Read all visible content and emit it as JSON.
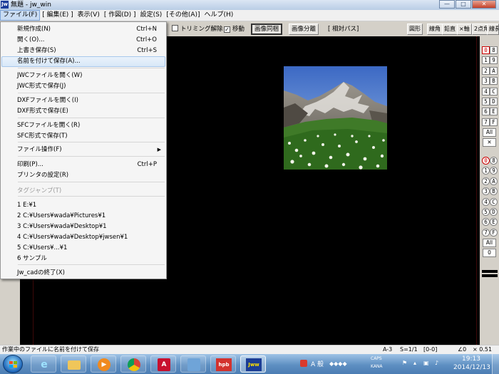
{
  "window": {
    "title": "無題 - jw_win",
    "icon_text": "Jw"
  },
  "menubar": [
    "ファイル(F)",
    "[ 編集(E) ]",
    "表示(V)",
    "[ 作図(D) ]",
    "設定(S)",
    "[その他(A)]",
    "ヘルプ(H)"
  ],
  "toolbar": {
    "trimming": "トリミング解除",
    "move": "移動",
    "move_checked": "✓",
    "image_same": "画像同梱",
    "image_split": "画像分離",
    "relative_path": "[ 相対パス]",
    "right_buttons": [
      "図形",
      "線角",
      "鉛直",
      "×軸",
      "2点角",
      "線長"
    ]
  },
  "file_menu": {
    "items": [
      {
        "label": "新規作成(N)",
        "shortcut": "Ctrl+N"
      },
      {
        "label": "開く(O)...",
        "shortcut": "Ctrl+O"
      },
      {
        "label": "上書き保存(S)",
        "shortcut": "Ctrl+S"
      },
      {
        "label": "名前を付けて保存(A)...",
        "shortcut": ""
      },
      {
        "label": "JWCファイルを開く(W)",
        "shortcut": ""
      },
      {
        "label": "JWC形式で保存(J)",
        "shortcut": ""
      },
      {
        "label": "DXFファイルを開く(I)",
        "shortcut": ""
      },
      {
        "label": "DXF形式で保存(E)",
        "shortcut": ""
      },
      {
        "label": "SFCファイルを開く(R)",
        "shortcut": ""
      },
      {
        "label": "SFC形式で保存(T)",
        "shortcut": ""
      },
      {
        "label": "ファイル操作(F)",
        "shortcut": "",
        "submenu_arrow": "▶"
      },
      {
        "label": "印刷(P)...",
        "shortcut": "Ctrl+P"
      },
      {
        "label": "プリンタの設定(R)",
        "shortcut": ""
      },
      {
        "label": "タグジャンプ(T)",
        "shortcut": ""
      },
      {
        "label": "1 E:¥1",
        "shortcut": ""
      },
      {
        "label": "2 C:¥Users¥wada¥Pictures¥1",
        "shortcut": ""
      },
      {
        "label": "3 C:¥Users¥wada¥Desktop¥1",
        "shortcut": ""
      },
      {
        "label": "4 C:¥Users¥wada¥Desktop¥jwsen¥1",
        "shortcut": ""
      },
      {
        "label": "5 C:¥Users¥...¥1",
        "shortcut": ""
      },
      {
        "label": "6 サンプル",
        "shortcut": ""
      },
      {
        "label": "Jw_cadの終了(X)",
        "shortcut": ""
      }
    ]
  },
  "right_panel": {
    "layer_group_buttons": [
      "0",
      "8",
      "1",
      "9",
      "2",
      "A",
      "3",
      "B",
      "4",
      "C",
      "5",
      "D",
      "6",
      "E",
      "7",
      "F"
    ],
    "all_label": "All",
    "cross_label": "✕",
    "layer_buttons": [
      "0",
      "8",
      "1",
      "9",
      "2",
      "A",
      "3",
      "B",
      "4",
      "C",
      "5",
      "D",
      "6",
      "E",
      "7",
      "F"
    ],
    "all_label_2": "All",
    "zero_label": "0"
  },
  "statusbar": {
    "message": "作業中のファイルに名前を付けて保存",
    "paper": "A-3",
    "scale": "S=1/1",
    "layer": "[0-0]",
    "angle": "∠0",
    "ratio": "× 0.51"
  },
  "taskbar": {
    "hpb_label": "hpb",
    "jww_label": "Jww",
    "tray_text": "A 般",
    "caps": "CAPS",
    "kana": "KANA",
    "time": "19:13",
    "date": "2014/12/13"
  }
}
